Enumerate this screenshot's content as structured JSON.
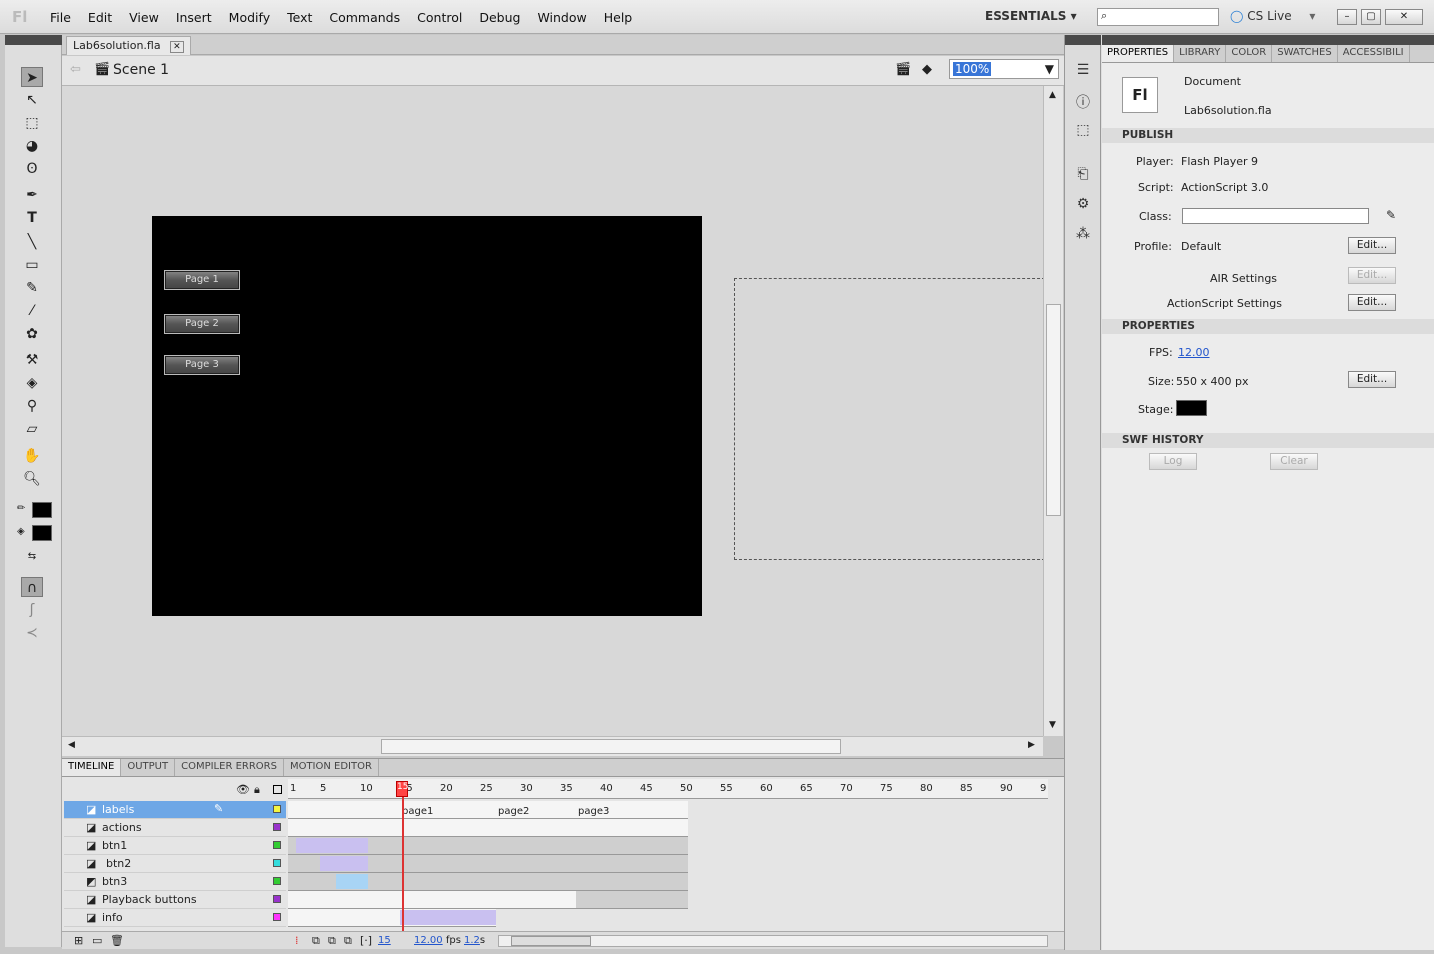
{
  "app": {
    "logo": "Fl",
    "workspace": "ESSENTIALS",
    "cs_live": "CS Live"
  },
  "menus": [
    "File",
    "Edit",
    "View",
    "Insert",
    "Modify",
    "Text",
    "Commands",
    "Control",
    "Debug",
    "Window",
    "Help"
  ],
  "document": {
    "tab": "Lab6solution.fla",
    "scene": "Scene 1",
    "zoom": "100%"
  },
  "stage_buttons": [
    "Page 1",
    "Page 2",
    "Page 3"
  ],
  "timeline": {
    "tabs": [
      "TIMELINE",
      "OUTPUT",
      "COMPILER ERRORS",
      "MOTION EDITOR"
    ],
    "ruler": [
      "1",
      "5",
      "10",
      "15",
      "20",
      "25",
      "30",
      "35",
      "40",
      "45",
      "50",
      "55",
      "60",
      "65",
      "70",
      "75",
      "80",
      "85",
      "90",
      "9"
    ],
    "layers": [
      {
        "name": "labels",
        "color": "#f5f540"
      },
      {
        "name": "actions",
        "color": "#9933cc"
      },
      {
        "name": "btn1",
        "color": "#33cc33"
      },
      {
        "name": "btn2",
        "color": "#33dddd"
      },
      {
        "name": "btn3",
        "color": "#33cc33"
      },
      {
        "name": "Playback buttons",
        "color": "#9933cc"
      },
      {
        "name": "info",
        "color": "#ff33ff"
      }
    ],
    "frame_labels": [
      "page1",
      "page2",
      "page3"
    ],
    "current_frame": "15",
    "fps": "12.00",
    "fps_unit": "fps",
    "time": "1.2",
    "time_unit": "s"
  },
  "properties": {
    "tabs": [
      "PROPERTIES",
      "LIBRARY",
      "COLOR",
      "SWATCHES",
      "ACCESSIBILI"
    ],
    "doc_type": "Document",
    "doc_name": "Lab6solution.fla",
    "publish_header": "PUBLISH",
    "player_label": "Player:",
    "player": "Flash Player 9",
    "script_label": "Script:",
    "script": "ActionScript 3.0",
    "class_label": "Class:",
    "profile_label": "Profile:",
    "profile": "Default",
    "air_settings": "AIR Settings",
    "as_settings": "ActionScript Settings",
    "edit_label": "Edit...",
    "props_header": "PROPERTIES",
    "fps_label": "FPS:",
    "fps": "12.00",
    "size_label": "Size:",
    "size": "550 x 400 px",
    "stage_label": "Stage:",
    "stage_color": "#000000",
    "swf_header": "SWF HISTORY",
    "log": "Log",
    "clear": "Clear"
  }
}
